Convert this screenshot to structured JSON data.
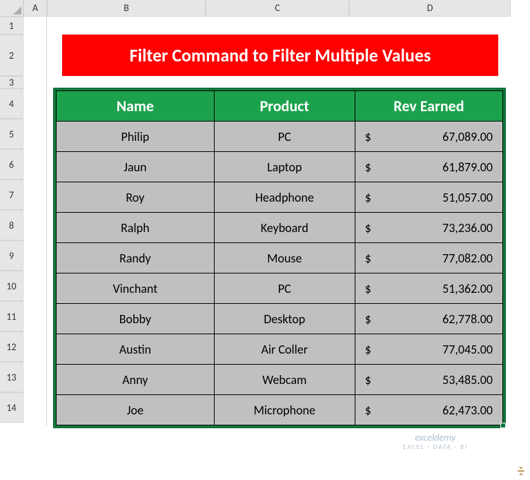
{
  "columns": [
    "A",
    "B",
    "C",
    "D"
  ],
  "rows": [
    "1",
    "2",
    "3",
    "4",
    "5",
    "6",
    "7",
    "8",
    "9",
    "10",
    "11",
    "12",
    "13",
    "14"
  ],
  "title": "Filter Command to Filter Multiple Values",
  "headers": {
    "name": "Name",
    "product": "Product",
    "rev": "Rev Earned"
  },
  "currency": "$",
  "data": [
    {
      "name": "Philip",
      "product": "PC",
      "rev": "67,089.00"
    },
    {
      "name": "Jaun",
      "product": "Laptop",
      "rev": "61,879.00"
    },
    {
      "name": "Roy",
      "product": "Headphone",
      "rev": "51,057.00"
    },
    {
      "name": "Ralph",
      "product": "Keyboard",
      "rev": "73,236.00"
    },
    {
      "name": "Randy",
      "product": "Mouse",
      "rev": "77,082.00"
    },
    {
      "name": "Vinchant",
      "product": "PC",
      "rev": "51,362.00"
    },
    {
      "name": "Bobby",
      "product": "Desktop",
      "rev": "62,778.00"
    },
    {
      "name": "Austin",
      "product": "Air Coller",
      "rev": "77,045.00"
    },
    {
      "name": "Anny",
      "product": "Webcam",
      "rev": "53,485.00"
    },
    {
      "name": "Joe",
      "product": "Microphone",
      "rev": "62,473.00"
    }
  ],
  "watermark": {
    "main": "exceldemy",
    "sub": "EXCEL · DATA · BI"
  },
  "chart_data": {
    "type": "table",
    "title": "Filter Command to Filter Multiple Values",
    "columns": [
      "Name",
      "Product",
      "Rev Earned"
    ],
    "rows": [
      [
        "Philip",
        "PC",
        67089.0
      ],
      [
        "Jaun",
        "Laptop",
        61879.0
      ],
      [
        "Roy",
        "Headphone",
        51057.0
      ],
      [
        "Ralph",
        "Keyboard",
        73236.0
      ],
      [
        "Randy",
        "Mouse",
        77082.0
      ],
      [
        "Vinchant",
        "PC",
        51362.0
      ],
      [
        "Bobby",
        "Desktop",
        62778.0
      ],
      [
        "Austin",
        "Air Coller",
        77045.0
      ],
      [
        "Anny",
        "Webcam",
        53485.0
      ],
      [
        "Joe",
        "Microphone",
        62473.0
      ]
    ]
  }
}
